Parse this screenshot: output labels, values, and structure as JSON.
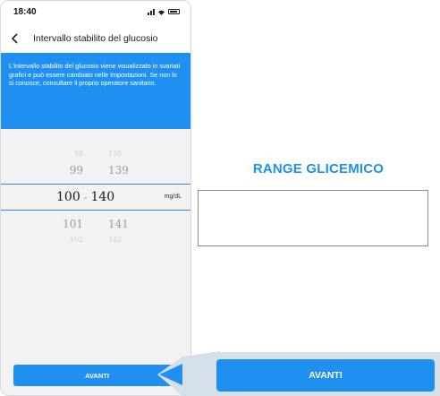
{
  "status": {
    "time": "18:40"
  },
  "nav": {
    "title": "Intervallo stabilito del glucosio"
  },
  "info": {
    "text": "L'intervallo stabilito del glucosio viene visualizzato in svariati grafici e può essere cambiato nelle Impostazioni. Se non lo si conosce, consultare il proprio operatore sanitario."
  },
  "picker": {
    "row_far_top": {
      "low": "98",
      "high": "138"
    },
    "row_near_top": {
      "low": "99",
      "high": "139"
    },
    "selected": {
      "low": "100",
      "separator": "-",
      "high": "140"
    },
    "row_near_bottom": {
      "low": "101",
      "high": "141"
    },
    "row_far_bottom": {
      "low": "102",
      "high": "142"
    },
    "unit": "mg/dL"
  },
  "buttons": {
    "avanti_small": "AVANTI",
    "avanti_big": "AVANTI"
  },
  "annotation": {
    "range_label": "RANGE GLICEMICO"
  },
  "colors": {
    "accent": "#1f8ff0",
    "frame": "#d6e0eb"
  }
}
